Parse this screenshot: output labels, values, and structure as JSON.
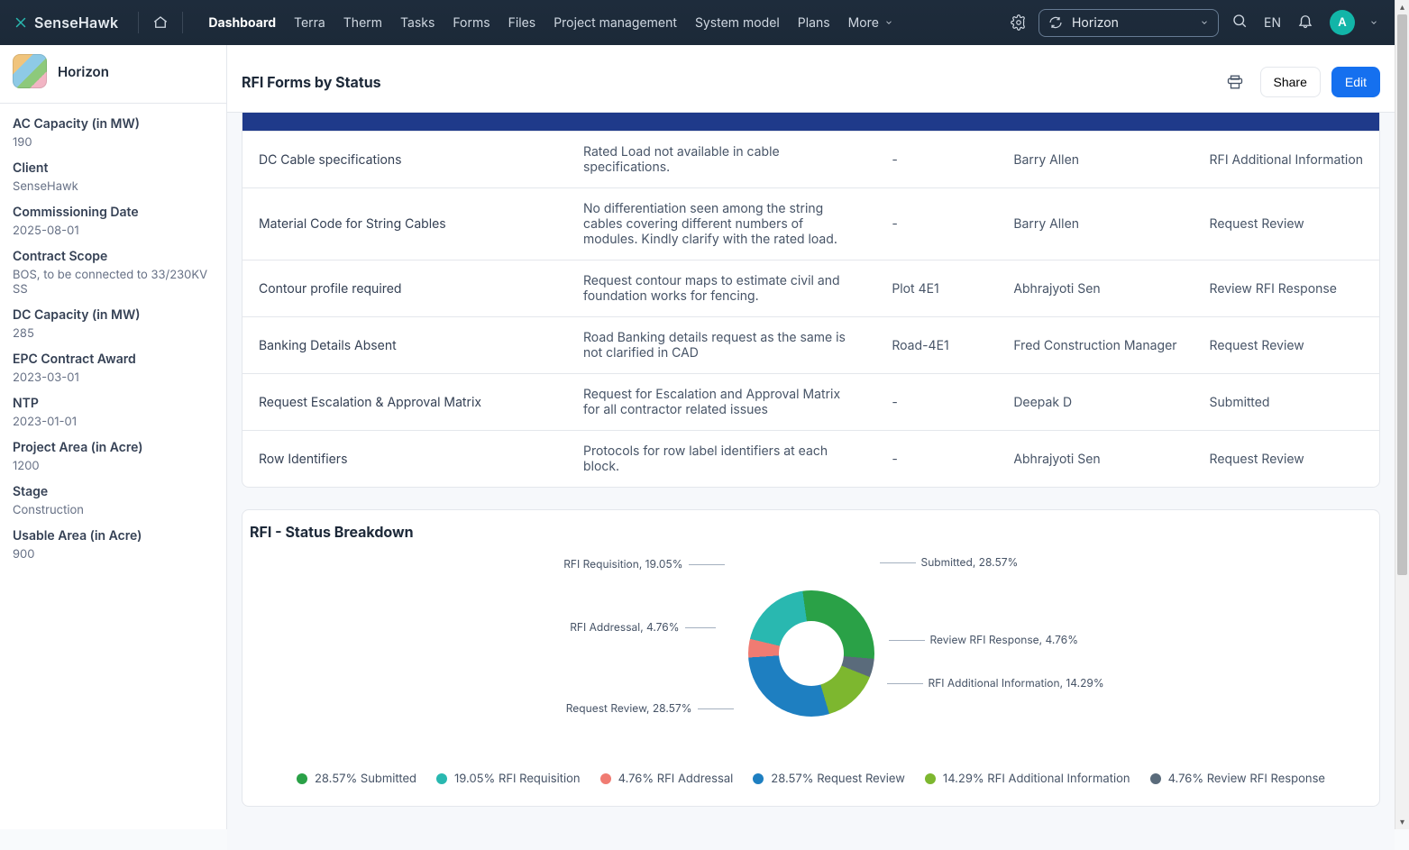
{
  "brand": {
    "name": "SenseHawk"
  },
  "nav": {
    "links": [
      "Dashboard",
      "Terra",
      "Therm",
      "Tasks",
      "Forms",
      "Files",
      "Project management",
      "System model",
      "Plans"
    ],
    "more_label": "More",
    "language": "EN",
    "project_picker": {
      "name": "Horizon"
    },
    "avatar_initial": "A"
  },
  "sidebar": {
    "project_title": "Horizon",
    "meta": [
      {
        "label": "AC Capacity (in MW)",
        "value": "190"
      },
      {
        "label": "Client",
        "value": "SenseHawk"
      },
      {
        "label": "Commissioning Date",
        "value": "2025-08-01"
      },
      {
        "label": "Contract Scope",
        "value": "BOS, to be connected to 33/230KV SS"
      },
      {
        "label": "DC Capacity (in MW)",
        "value": "285"
      },
      {
        "label": "EPC Contract Award",
        "value": "2023-03-01"
      },
      {
        "label": "NTP",
        "value": "2023-01-01"
      },
      {
        "label": "Project Area (in Acre)",
        "value": "1200"
      },
      {
        "label": "Stage",
        "value": "Construction"
      },
      {
        "label": "Usable Area (in Acre)",
        "value": "900"
      }
    ]
  },
  "page": {
    "title": "RFI Forms by Status",
    "actions": {
      "share_label": "Share",
      "edit_label": "Edit"
    }
  },
  "table": {
    "rows": [
      {
        "title": "DC Cable specifications",
        "desc": "Rated Load not available in cable specifications.",
        "loc": "-",
        "assignee": "Barry Allen",
        "status": "RFI Additional Information"
      },
      {
        "title": "Material Code for String Cables",
        "desc": "No differentiation seen among the string cables covering different numbers of modules. Kindly clarify with the rated load.",
        "loc": "-",
        "assignee": "Barry Allen",
        "status": "Request Review"
      },
      {
        "title": "Contour profile required",
        "desc": "Request contour maps to estimate civil and foundation works for fencing.",
        "loc": "Plot 4E1",
        "assignee": "Abhrajyoti Sen",
        "status": "Review RFI Response"
      },
      {
        "title": "Banking Details Absent",
        "desc": "Road Banking details request as the same is not clarified in CAD",
        "loc": "Road-4E1",
        "assignee": "Fred Construction Manager",
        "status": "Request Review"
      },
      {
        "title": "Request Escalation & Approval Matrix",
        "desc": "Request for Escalation and Approval Matrix for all contractor related issues",
        "loc": "-",
        "assignee": "Deepak D",
        "status": "Submitted"
      },
      {
        "title": "Row Identifiers",
        "desc": "Protocols for row label identifiers at each block.",
        "loc": "-",
        "assignee": "Abhrajyoti Sen",
        "status": "Request Review"
      }
    ]
  },
  "chart_card": {
    "title": "RFI - Status Breakdown"
  },
  "chart_data": {
    "type": "pie",
    "title": "RFI - Status Breakdown",
    "series": [
      {
        "name": "Submitted",
        "value": 28.57,
        "color": "#2aa147"
      },
      {
        "name": "RFI Requisition",
        "value": 19.05,
        "color": "#29b8b0"
      },
      {
        "name": "RFI Addressal",
        "value": 4.76,
        "color": "#f07b72"
      },
      {
        "name": "Request Review",
        "value": 28.57,
        "color": "#1e7fc1"
      },
      {
        "name": "RFI Additional Information",
        "value": 14.29,
        "color": "#7db72f"
      },
      {
        "name": "Review RFI Response",
        "value": 4.76,
        "color": "#5a6b7b"
      }
    ],
    "callouts": [
      {
        "text": "Submitted, 28.57%"
      },
      {
        "text": "RFI Requisition, 19.05%"
      },
      {
        "text": "RFI Addressal, 4.76%"
      },
      {
        "text": "Request Review, 28.57%"
      },
      {
        "text": "RFI Additional Information, 14.29%"
      },
      {
        "text": "Review RFI Response, 4.76%"
      }
    ],
    "legend": [
      {
        "label": "28.57% Submitted",
        "color": "#2aa147"
      },
      {
        "label": "19.05% RFI Requisition",
        "color": "#29b8b0"
      },
      {
        "label": "4.76% RFI Addressal",
        "color": "#f07b72"
      },
      {
        "label": "28.57% Request Review",
        "color": "#1e7fc1"
      },
      {
        "label": "14.29% RFI Additional Information",
        "color": "#7db72f"
      },
      {
        "label": "4.76% Review RFI Response",
        "color": "#5a6b7b"
      }
    ]
  }
}
